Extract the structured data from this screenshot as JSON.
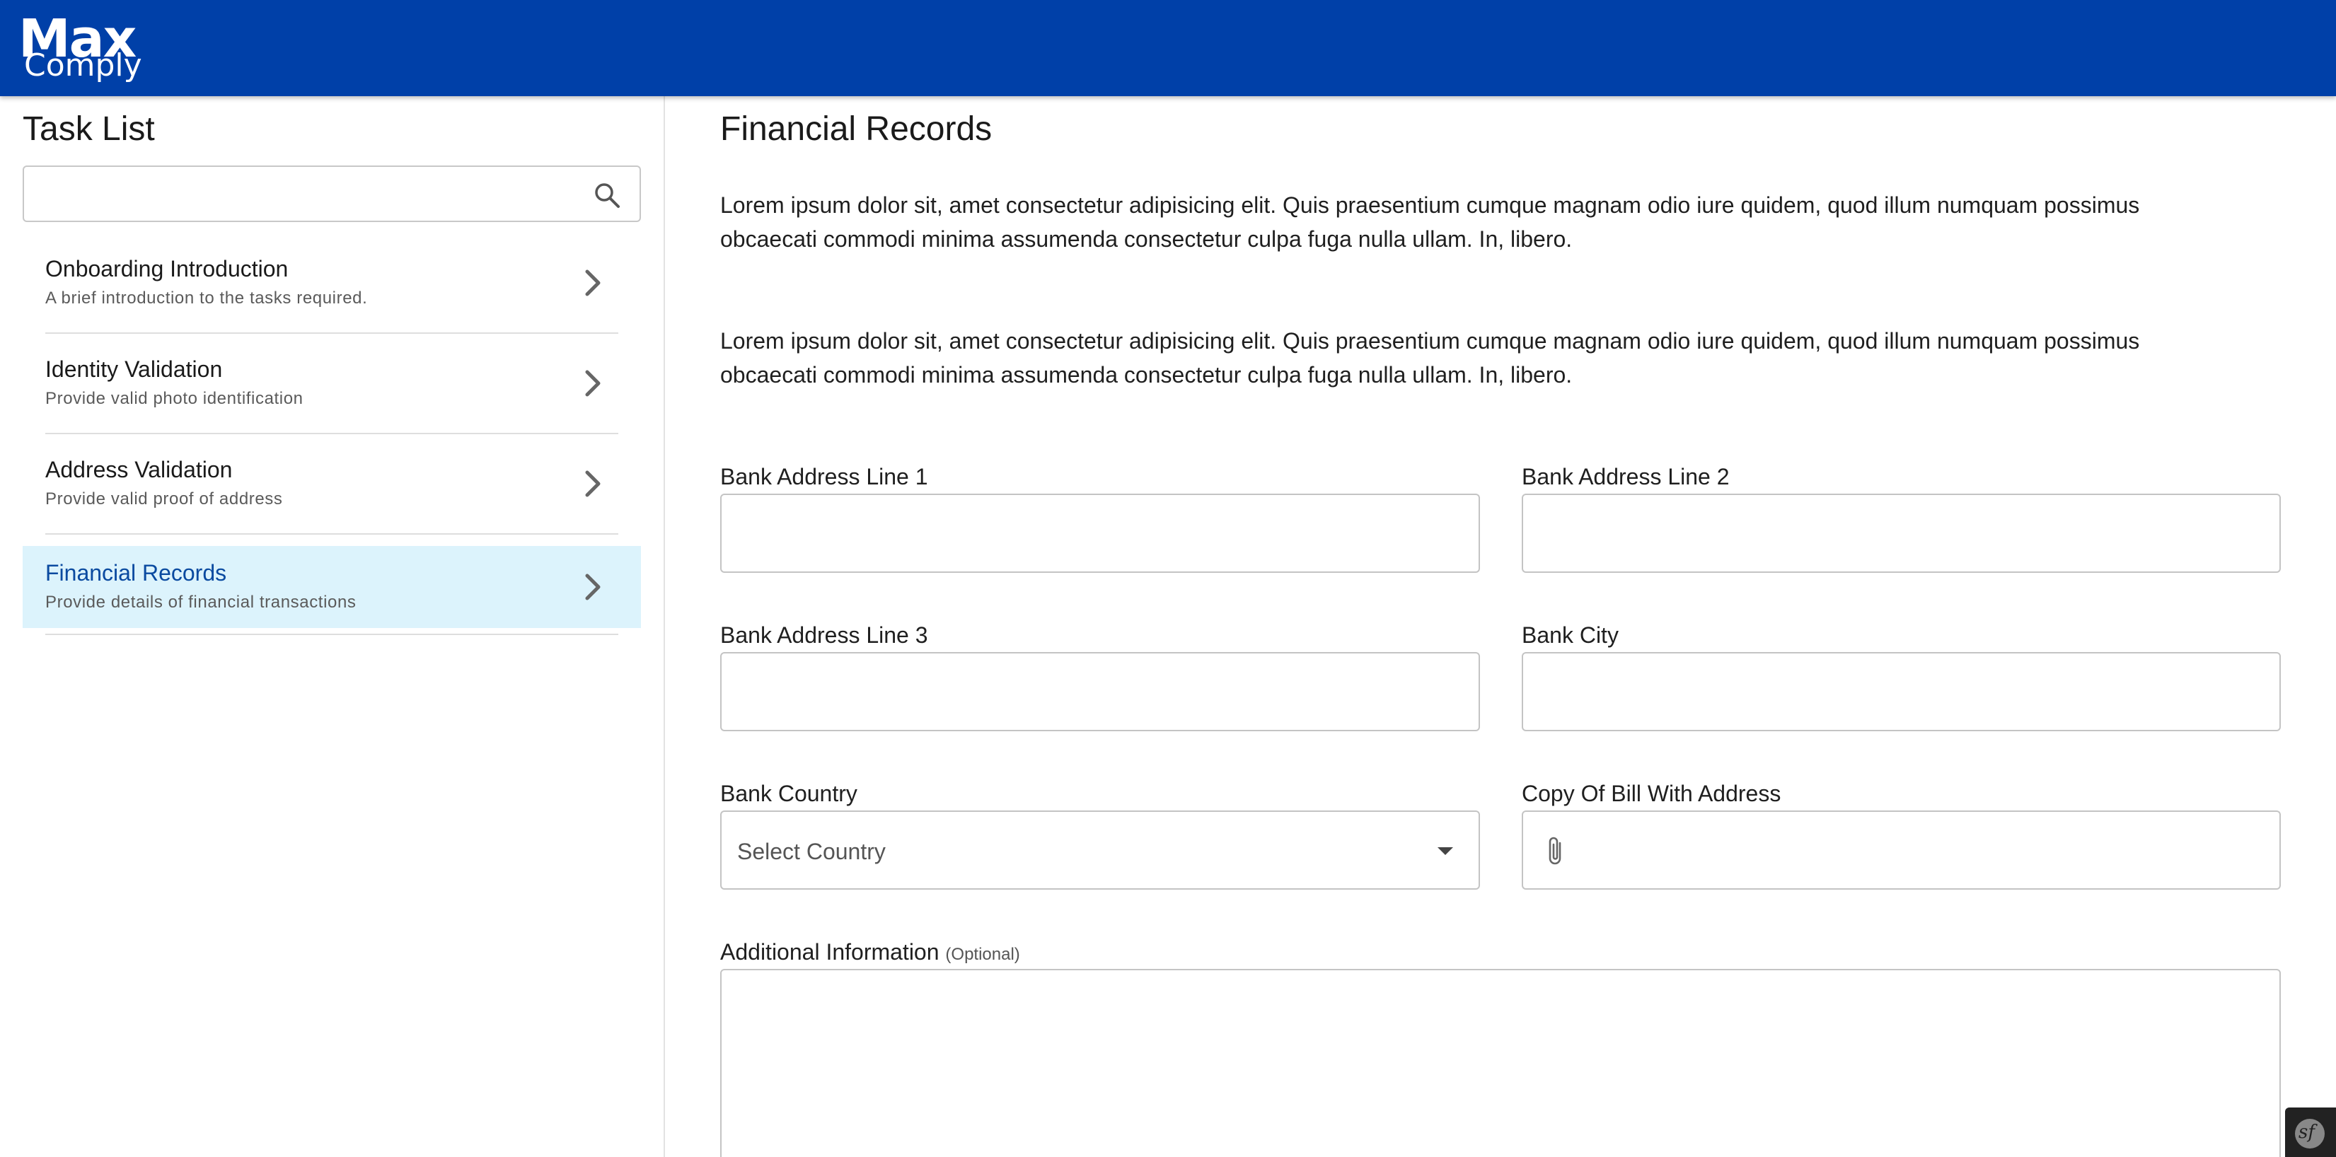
{
  "header": {
    "logo_max": "Max",
    "logo_comply": "Comply",
    "background": "#0040a8"
  },
  "sidebar": {
    "title": "Task List",
    "search": {
      "value": "",
      "placeholder": ""
    },
    "items": [
      {
        "title": "Onboarding Introduction",
        "subtitle": "A brief introduction to the tasks required.",
        "active": false
      },
      {
        "title": "Identity Validation",
        "subtitle": "Provide valid photo identification",
        "active": false
      },
      {
        "title": "Address Validation",
        "subtitle": "Provide valid proof of address",
        "active": false
      },
      {
        "title": "Financial Records",
        "subtitle": "Provide details of financial transactions",
        "active": true
      }
    ],
    "active_color": "#dcf3fc"
  },
  "main": {
    "title": "Financial Records",
    "paragraphs": [
      "Lorem ipsum dolor sit, amet consectetur adipisicing elit. Quis praesentium cumque magnam odio iure quidem, quod illum numquam possimus obcaecati commodi minima assumenda consectetur culpa fuga nulla ullam. In, libero.",
      "Lorem ipsum dolor sit, amet consectetur adipisicing elit. Quis praesentium cumque magnam odio iure quidem, quod illum numquam possimus obcaecati commodi minima assumenda consectetur culpa fuga nulla ullam. In, libero."
    ],
    "fields": {
      "bank_address_line_1": {
        "label": "Bank Address Line 1",
        "value": ""
      },
      "bank_address_line_2": {
        "label": "Bank Address Line 2",
        "value": ""
      },
      "bank_address_line_3": {
        "label": "Bank Address Line 3",
        "value": ""
      },
      "bank_city": {
        "label": "Bank City",
        "value": ""
      },
      "bank_country": {
        "label": "Bank Country",
        "selected": "Select Country"
      },
      "copy_of_bill": {
        "label": "Copy Of Bill With Address",
        "value": ""
      },
      "additional_information": {
        "label": "Additional Information",
        "optional": "(Optional)",
        "value": ""
      }
    }
  },
  "debug_badge": {
    "text": "sf"
  }
}
